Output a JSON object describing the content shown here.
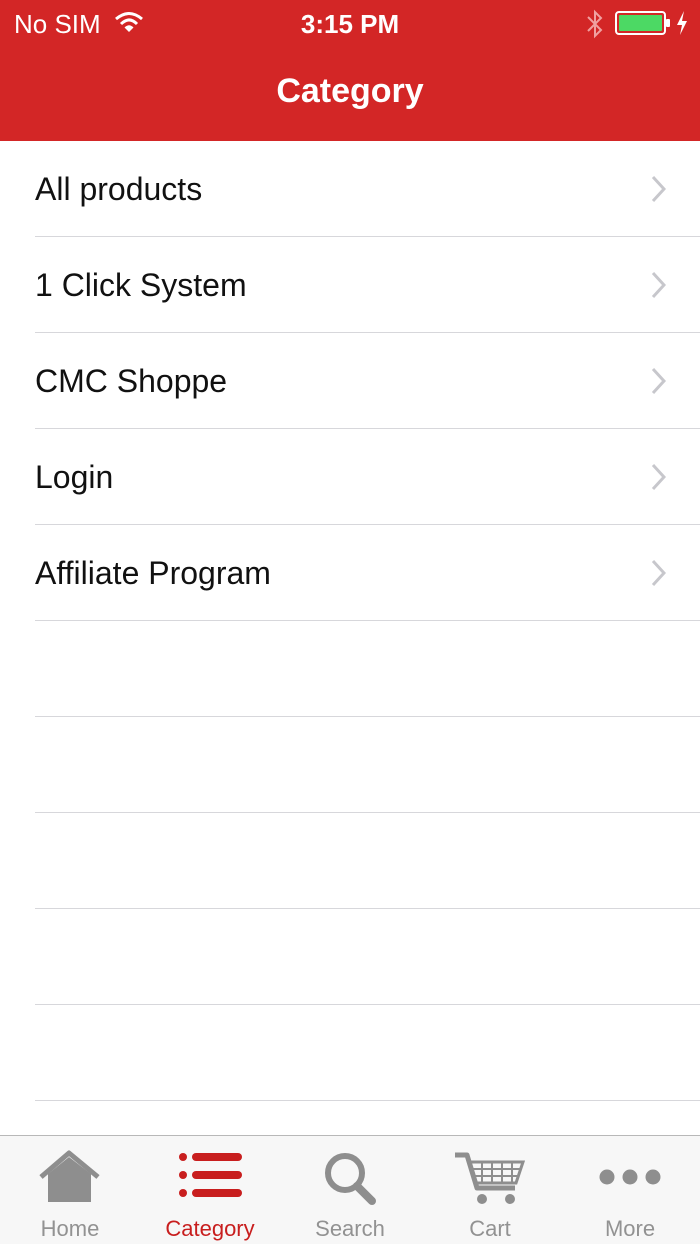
{
  "status_bar": {
    "carrier": "No SIM",
    "time": "3:15 PM"
  },
  "nav": {
    "title": "Category"
  },
  "list": {
    "items": [
      {
        "label": "All products"
      },
      {
        "label": "1 Click System"
      },
      {
        "label": "CMC Shoppe"
      },
      {
        "label": "Login"
      },
      {
        "label": "Affiliate Program"
      }
    ]
  },
  "tabbar": {
    "tabs": [
      {
        "label": "Home",
        "icon": "home-icon"
      },
      {
        "label": "Category",
        "icon": "list-icon",
        "selected": true
      },
      {
        "label": "Search",
        "icon": "search-icon"
      },
      {
        "label": "Cart",
        "icon": "cart-icon"
      },
      {
        "label": "More",
        "icon": "more-icon"
      }
    ]
  },
  "colors": {
    "header_bg": "#d32626",
    "active_tab": "#c81e1e",
    "inactive_tab": "#929292",
    "battery": "#4cd964"
  }
}
